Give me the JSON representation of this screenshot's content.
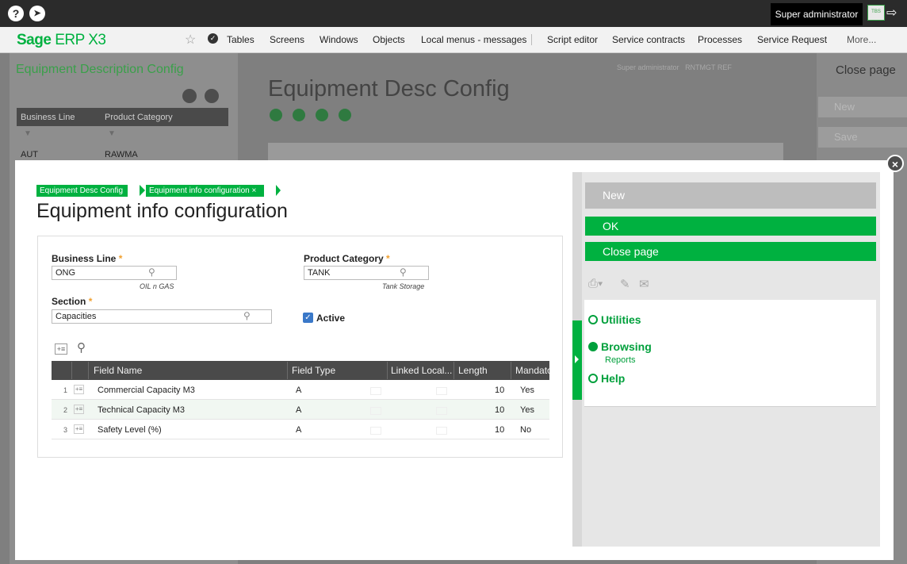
{
  "topbar": {
    "help_icon": "?",
    "compass_icon": "compass-icon",
    "user": "Super administrator",
    "flag_text": "TBS"
  },
  "menubar": {
    "brand_bold": "Sage",
    "brand_thin": " ERP X3",
    "items": [
      "Tables",
      "Screens",
      "Windows",
      "Objects",
      "Local menus - messages",
      "Script editor",
      "Service contracts",
      "Processes",
      "Service Request",
      "More..."
    ]
  },
  "background": {
    "left_title": "Equipment Description Config",
    "left_columns": [
      "Business Line",
      "Product Category"
    ],
    "left_row": [
      "AUT",
      "RAWMA"
    ],
    "mid_title": "Equipment Desc Config",
    "badges": [
      "Super administrator",
      "RNTMGT REF"
    ],
    "right_close": "Close page",
    "right_buttons": [
      "New",
      "Save"
    ]
  },
  "breadcrumb": {
    "item1": "Equipment Desc Config",
    "item2": "Equipment info configuration",
    "close_glyph": "×"
  },
  "page": {
    "title": "Equipment info configuration"
  },
  "form": {
    "business_line": {
      "label": "Business Line",
      "value": "ONG",
      "hint": "OIL n GAS"
    },
    "product_category": {
      "label": "Product Category",
      "value": "TANK",
      "hint": "Tank Storage"
    },
    "section": {
      "label": "Section",
      "value": "Capacities"
    },
    "active": {
      "label": "Active",
      "checked": true
    }
  },
  "grid": {
    "columns": [
      "Field Name",
      "Field Type",
      "Linked Local...",
      "Length",
      "Mandato"
    ],
    "rows": [
      {
        "num": "1",
        "field_name": "Commercial Capacity M3",
        "field_type": "A",
        "length": "10",
        "mandatory": "Yes"
      },
      {
        "num": "2",
        "field_name": "Technical Capacity M3",
        "field_type": "A",
        "length": "10",
        "mandatory": "Yes"
      },
      {
        "num": "3",
        "field_name": "Safety Level (%)",
        "field_type": "A",
        "length": "10",
        "mandatory": "No"
      }
    ]
  },
  "actions": {
    "new": "New",
    "ok": "OK",
    "close_page": "Close page"
  },
  "side_menu": {
    "utilities": "Utilities",
    "browsing": "Browsing",
    "reports": "Reports",
    "help": "Help"
  },
  "colors": {
    "accent_green": "#00b140",
    "dark_bar": "#2b2b2b",
    "required_star": "#f0a030"
  }
}
